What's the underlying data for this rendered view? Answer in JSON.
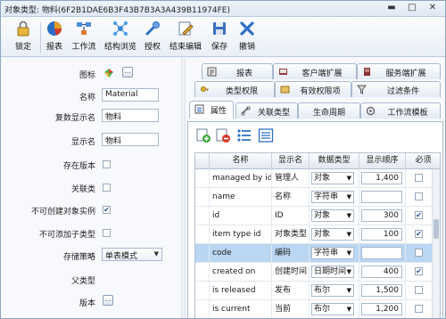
{
  "window": {
    "title": "对象类型: 物料(6F2B1DAE6B3F43B7B3A3A439B11974FE)"
  },
  "toolbar": {
    "buttons": [
      {
        "label": "锁定",
        "icon": "lock-icon"
      },
      {
        "label": "报表",
        "icon": "report-icon"
      },
      {
        "label": "工作流",
        "icon": "workflow-icon"
      },
      {
        "label": "结构浏览",
        "icon": "structure-icon"
      },
      {
        "label": "授权",
        "icon": "authorize-icon"
      },
      {
        "label": "结束编辑",
        "icon": "end-edit-icon"
      },
      {
        "label": "保存",
        "icon": "save-icon"
      },
      {
        "label": "撤销",
        "icon": "undo-icon"
      }
    ]
  },
  "properties": {
    "icon_label": "图标",
    "name_label": "名称",
    "name_value": "Material",
    "plural_label": "复数显示名",
    "plural_value": "物料",
    "display_label": "显示名",
    "display_value": "物料",
    "versioned_label": "存在版本",
    "versioned": false,
    "relation_label": "关联类",
    "relation": false,
    "no_instance_label": "不可创建对象实例",
    "no_instance": true,
    "no_subtype_label": "不可添加子类型",
    "no_subtype": false,
    "storage_label": "存储策略",
    "storage_value": "单表模式",
    "parent_label": "父类型",
    "version_label": "版本",
    "more_button": "..."
  },
  "tabs": {
    "row1": [
      "报表",
      "客户端扩展",
      "服务端扩展"
    ],
    "row2": [
      "类型权限",
      "有效权限项",
      "过滤条件"
    ],
    "row3": [
      "属性",
      "关联类型",
      "生命周期",
      "工作流模板"
    ],
    "active": "属性"
  },
  "grid": {
    "headers": [
      "名称",
      "显示名",
      "数据类型",
      "显示顺序",
      "必须"
    ],
    "rows": [
      {
        "name": "managed by id",
        "display": "管理人",
        "type": "对象",
        "order": "1,400",
        "required": false,
        "selected": false
      },
      {
        "name": "name",
        "display": "名称",
        "type": "字符串",
        "order": "",
        "required": false,
        "selected": false
      },
      {
        "name": "id",
        "display": "ID",
        "type": "对象",
        "order": "300",
        "required": true,
        "selected": false
      },
      {
        "name": "item type id",
        "display": "对象类型",
        "type": "对象",
        "order": "100",
        "required": true,
        "selected": false
      },
      {
        "name": "code",
        "display": "编码",
        "type": "字符串",
        "order": "",
        "required": false,
        "selected": true
      },
      {
        "name": "created on",
        "display": "创建时间",
        "type": "日期时间",
        "order": "400",
        "required": true,
        "selected": false
      },
      {
        "name": "is released",
        "display": "发布",
        "type": "布尔",
        "order": "1,500",
        "required": false,
        "selected": false
      },
      {
        "name": "is current",
        "display": "当前",
        "type": "布尔",
        "order": "1,200",
        "required": false,
        "selected": false
      }
    ]
  },
  "colors": {
    "accent": "#2f6fc6",
    "selected_row": "#b9d6f3",
    "border": "#a9b9cf"
  }
}
